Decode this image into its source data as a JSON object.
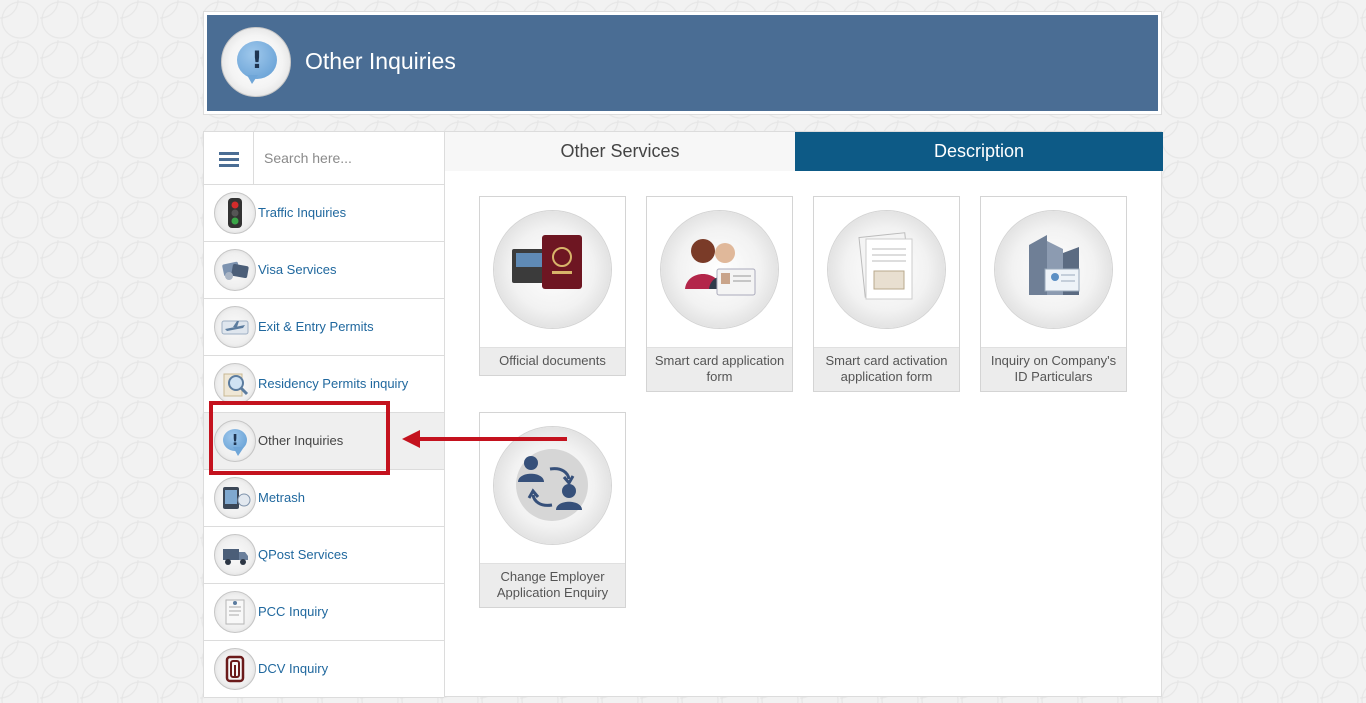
{
  "header": {
    "title": "Other Inquiries",
    "icon": "exclamation-bubble-icon"
  },
  "search": {
    "placeholder": "Search here..."
  },
  "sidebar": {
    "items": [
      {
        "label": "Traffic Inquiries",
        "icon": "traffic-light-icon"
      },
      {
        "label": "Visa Services",
        "icon": "visa-icon"
      },
      {
        "label": "Exit & Entry Permits",
        "icon": "airplane-icon"
      },
      {
        "label": "Residency Permits inquiry",
        "icon": "magnifier-icon"
      },
      {
        "label": "Other Inquiries",
        "icon": "exclamation-bubble-icon",
        "active": true
      },
      {
        "label": "Metrash",
        "icon": "metrash-icon"
      },
      {
        "label": "QPost Services",
        "icon": "delivery-truck-icon"
      },
      {
        "label": "PCC Inquiry",
        "icon": "certificate-icon"
      },
      {
        "label": "DCV Inquiry",
        "icon": "dcv-logo-icon"
      }
    ]
  },
  "tabs": [
    {
      "label": "Other Services",
      "active": false
    },
    {
      "label": "Description",
      "active": true
    }
  ],
  "services": [
    {
      "label": "Official documents",
      "icon": "passport-icon"
    },
    {
      "label": "Smart card application form",
      "icon": "smart-card-icon"
    },
    {
      "label": "Smart card activation application form",
      "icon": "document-icon"
    },
    {
      "label": "Inquiry on Company's ID Particulars",
      "icon": "company-building-icon"
    },
    {
      "label": "Change Employer Application Enquiry",
      "icon": "change-employer-icon"
    }
  ],
  "colors": {
    "header": "#4a6d94",
    "active_tab": "#0d5a86",
    "link": "#20689e",
    "highlight": "#c4121e"
  }
}
